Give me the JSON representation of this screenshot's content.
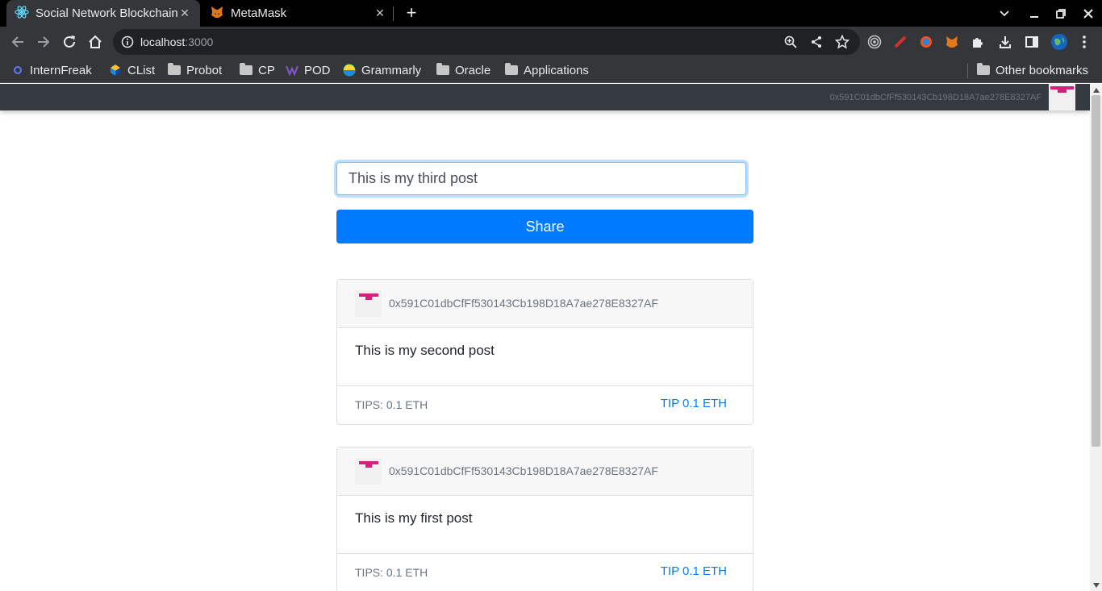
{
  "browser": {
    "tabs": [
      {
        "title": "Social Network Blockchain",
        "icon": "react-icon",
        "active": true
      },
      {
        "title": "MetaMask",
        "icon": "metamask-fox-icon",
        "active": false
      }
    ],
    "address": {
      "host": "localhost",
      "port": ":3000"
    },
    "bookmarks": [
      {
        "label": "InternFreak",
        "icon": "internfreak-icon"
      },
      {
        "label": "CList",
        "icon": "clist-icon"
      },
      {
        "label": "Probot",
        "icon": "folder-icon"
      },
      {
        "label": "CP",
        "icon": "folder-icon"
      },
      {
        "label": "POD",
        "icon": "pod-icon"
      },
      {
        "label": "Grammarly",
        "icon": "grammarly-icon"
      },
      {
        "label": "Oracle",
        "icon": "folder-icon"
      },
      {
        "label": "Applications",
        "icon": "folder-icon"
      },
      {
        "label": "Other bookmarks",
        "icon": "folder-icon"
      }
    ]
  },
  "app": {
    "account": "0x591C01dbCfFf530143Cb198D18A7ae278E8327AF",
    "post_input_value": "This is my third post",
    "share_label": "Share",
    "posts": [
      {
        "author": "0x591C01dbCfFf530143Cb198D18A7ae278E8327AF",
        "content": "This is my second post",
        "tips": "TIPS: 0.1 ETH",
        "tip_label": "TIP 0.1 ETH"
      },
      {
        "author": "0x591C01dbCfFf530143Cb198D18A7ae278E8327AF",
        "content": "This is my first post",
        "tips": "TIPS: 0.1 ETH",
        "tip_label": "TIP 0.1 ETH"
      }
    ]
  },
  "colors": {
    "primary": "#007bff",
    "navbar": "#343a40",
    "identicon": "#d61f7a"
  }
}
